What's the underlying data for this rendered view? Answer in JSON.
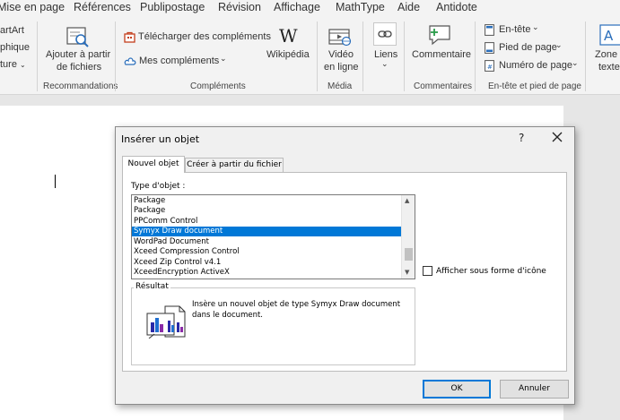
{
  "menu_tabs": [
    "Mise en page",
    "Références",
    "Publipostage",
    "Révision",
    "Affichage",
    "MathType",
    "Aide",
    "Antidote"
  ],
  "ribbon": {
    "left_partial": [
      "artArt",
      "phique",
      "ture"
    ],
    "add_files": "Ajouter à partir de fichiers",
    "add_files_line1": "Ajouter à partir",
    "add_files_line2": "de fichiers",
    "group_recommandations": "Recommandations",
    "telecharger": "Télécharger des compléments",
    "mes_complements": "Mes compléments",
    "wikipedia": "Wikipédia",
    "group_complements": "Compléments",
    "video_line1": "Vidéo",
    "video_line2": "en ligne",
    "group_media": "Média",
    "liens": "Liens",
    "commentaire": "Commentaire",
    "group_commentaires": "Commentaires",
    "en_tete": "En-tête",
    "pied_de_page": "Pied de page",
    "numero_de_page": "Numéro de page",
    "group_entete": "En-tête et pied de page",
    "zone_line1": "Zone d",
    "zone_line2": "texte"
  },
  "dialog": {
    "title": "Insérer un objet",
    "help": "?",
    "tab_new": "Nouvel objet",
    "tab_from_file": "Créer à partir du fichier",
    "type_label": "Type d'objet :",
    "object_types": [
      "Package",
      "Package",
      "PPComm Control",
      "Symyx Draw document",
      "WordPad Document",
      "Xceed Compression Control",
      "Xceed Zip Control v4.1",
      "XceedEncryption ActiveX"
    ],
    "selected_index": 3,
    "show_as_icon": "Afficher sous forme d'icône",
    "show_as_icon_checked": false,
    "result_label": "Résultat",
    "result_text": "Insère un nouvel objet de type Symyx Draw document dans le document.",
    "ok": "OK",
    "cancel": "Annuler"
  },
  "colors": {
    "selection": "#0078d7",
    "accent_red": "#c43e1c"
  }
}
